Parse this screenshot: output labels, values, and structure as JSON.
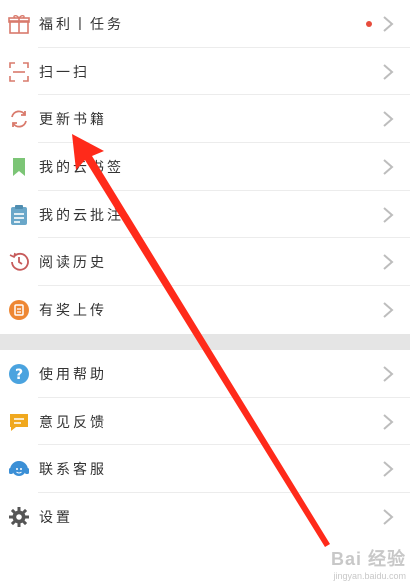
{
  "menu_top": [
    {
      "label": "福利丨任务",
      "icon": "gift-icon",
      "badge": true
    },
    {
      "label": "扫一扫",
      "icon": "scan-icon"
    },
    {
      "label": "更新书籍",
      "icon": "refresh-icon"
    },
    {
      "label": "我的云书签",
      "icon": "bookmark-icon"
    },
    {
      "label": "我的云批注",
      "icon": "clipboard-icon"
    },
    {
      "label": "阅读历史",
      "icon": "history-icon"
    },
    {
      "label": "有奖上传",
      "icon": "upload-reward-icon"
    }
  ],
  "menu_bottom": [
    {
      "label": "使用帮助",
      "icon": "help-icon"
    },
    {
      "label": "意见反馈",
      "icon": "feedback-icon"
    },
    {
      "label": "联系客服",
      "icon": "customer-service-icon"
    },
    {
      "label": "设置",
      "icon": "gear-icon"
    }
  ],
  "watermark": {
    "brand": "Bai 经验",
    "url": "jingyan.baidu.com"
  },
  "colors": {
    "badge": "#e74c3c",
    "arrow": "#ff2a1a",
    "divider": "#e5e5e5"
  }
}
